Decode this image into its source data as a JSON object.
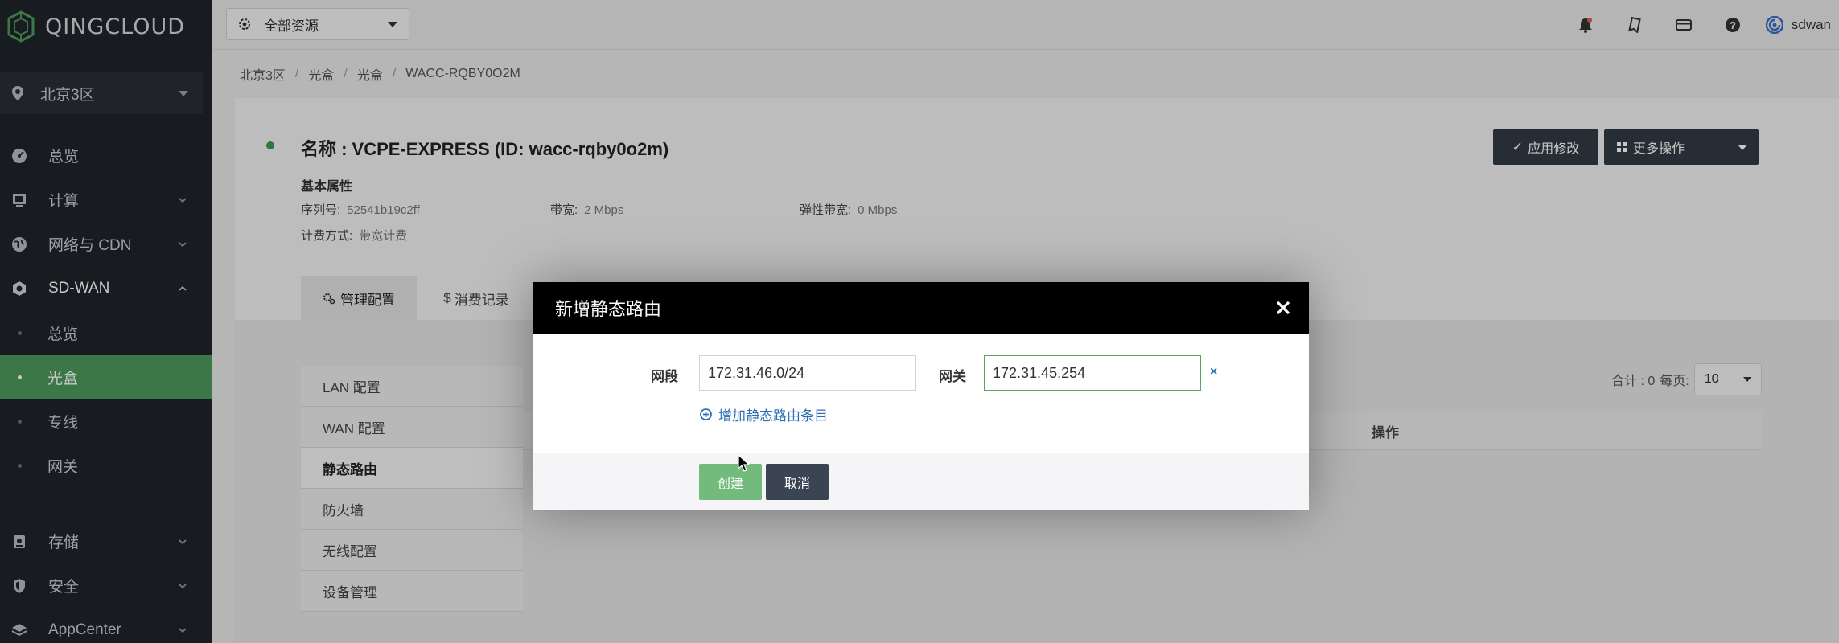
{
  "app": {
    "logo_text": "QINGCLOUD"
  },
  "sidebar": {
    "region": "北京3区",
    "items": [
      {
        "label": "总览",
        "icon": "dashboard-icon"
      },
      {
        "label": "计算",
        "icon": "compute-icon"
      },
      {
        "label": "网络与 CDN",
        "icon": "globe-icon"
      },
      {
        "label": "SD-WAN",
        "icon": "sdwan-icon"
      },
      {
        "label": "存储",
        "icon": "storage-icon"
      },
      {
        "label": "安全",
        "icon": "shield-icon"
      },
      {
        "label": "AppCenter",
        "icon": "layers-icon"
      }
    ],
    "sdwan_sub": [
      {
        "label": "总览"
      },
      {
        "label": "光盒"
      },
      {
        "label": "专线"
      },
      {
        "label": "网关"
      }
    ]
  },
  "topbar": {
    "resource_select": "全部资源",
    "username": "sdwan"
  },
  "breadcrumb": [
    "北京3区",
    "光盒",
    "光盒",
    "WACC-RQBY0O2M"
  ],
  "detail": {
    "name": "名称 : VCPE-EXPRESS (ID: wacc-rqby0o2m)",
    "section_title": "基本属性",
    "props": {
      "serial_label": "序列号:",
      "serial_value": "52541b19c2ff",
      "bandwidth_label": "带宽:",
      "bandwidth_value": "2 Mbps",
      "elastic_label": "弹性带宽:",
      "elastic_value": "0 Mbps",
      "billing_label": "计费方式:",
      "billing_value": "带宽计费"
    },
    "apply_button": "应用修改",
    "more_button": "更多操作"
  },
  "tabs": [
    {
      "label": "管理配置"
    },
    {
      "label": "消费记录"
    }
  ],
  "left_menu": [
    "LAN 配置",
    "WAN 配置",
    "静态路由",
    "防火墙",
    "无线配置",
    "设备管理"
  ],
  "table": {
    "total_label": "合计 : 0",
    "per_page_label": "每页:",
    "per_page_value": "10",
    "op_header": "操作"
  },
  "modal": {
    "title": "新增静态路由",
    "segment_label": "网段",
    "segment_value": "172.31.46.0/24",
    "gateway_label": "网关",
    "gateway_value": "172.31.45.254",
    "remove_symbol": "×",
    "add_link": "增加静态路由条目",
    "create_button": "创建",
    "cancel_button": "取消"
  },
  "colors": {
    "accent_green": "#4e9a5c",
    "link_blue": "#2d6fb5",
    "dark_button": "#333a43"
  }
}
